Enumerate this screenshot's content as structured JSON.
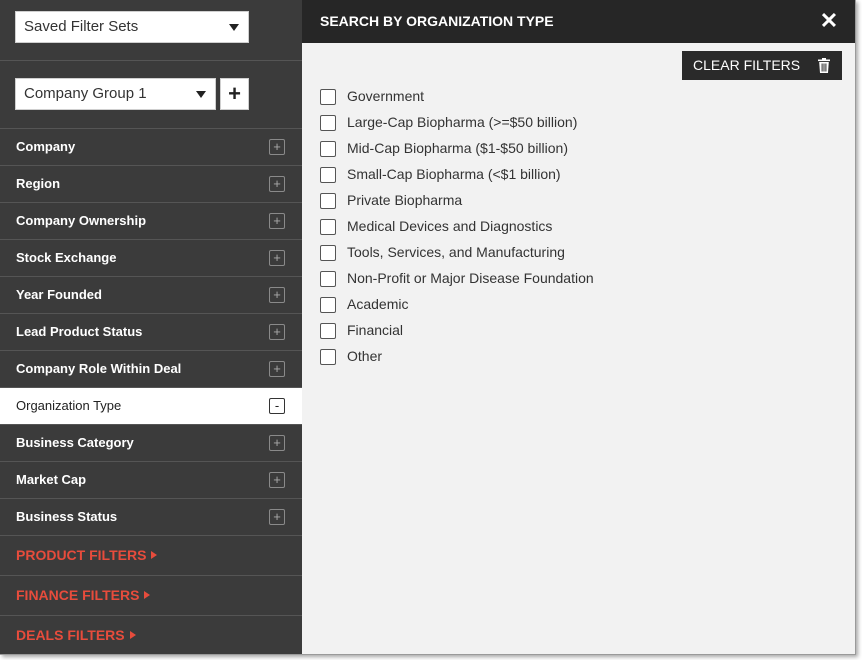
{
  "sidebar": {
    "saved_filter_sets": {
      "value": "Saved Filter Sets"
    },
    "company_group": {
      "value": "Company Group 1",
      "add_label": "+"
    },
    "filters": [
      {
        "label": "Company",
        "toggle": "+",
        "active": false
      },
      {
        "label": "Region",
        "toggle": "+",
        "active": false
      },
      {
        "label": "Company Ownership",
        "toggle": "+",
        "active": false
      },
      {
        "label": "Stock Exchange",
        "toggle": "+",
        "active": false
      },
      {
        "label": "Year Founded",
        "toggle": "+",
        "active": false
      },
      {
        "label": "Lead Product Status",
        "toggle": "+",
        "active": false
      },
      {
        "label": "Company Role Within Deal",
        "toggle": "+",
        "active": false
      },
      {
        "label": "Organization Type",
        "toggle": "-",
        "active": true
      },
      {
        "label": "Business Category",
        "toggle": "+",
        "active": false
      },
      {
        "label": "Market Cap",
        "toggle": "+",
        "active": false
      },
      {
        "label": "Business Status",
        "toggle": "+",
        "active": false
      }
    ],
    "sections": [
      {
        "label": "PRODUCT FILTERS"
      },
      {
        "label": "FINANCE FILTERS"
      },
      {
        "label": "DEALS FILTERS"
      }
    ]
  },
  "panel": {
    "title": "SEARCH BY ORGANIZATION TYPE",
    "close_label": "✕",
    "clear_label": "CLEAR FILTERS",
    "options": [
      {
        "label": "Government",
        "checked": false
      },
      {
        "label": "Large-Cap Biopharma (>=$50 billion)",
        "checked": false
      },
      {
        "label": "Mid-Cap Biopharma ($1-$50 billion)",
        "checked": false
      },
      {
        "label": "Small-Cap Biopharma (<$1 billion)",
        "checked": false
      },
      {
        "label": "Private Biopharma",
        "checked": false
      },
      {
        "label": "Medical Devices and Diagnostics",
        "checked": false
      },
      {
        "label": "Tools, Services, and Manufacturing",
        "checked": false
      },
      {
        "label": "Non-Profit or Major Disease Foundation",
        "checked": false
      },
      {
        "label": "Academic",
        "checked": false
      },
      {
        "label": "Financial",
        "checked": false
      },
      {
        "label": "Other",
        "checked": false
      }
    ]
  },
  "colors": {
    "sidebar_bg": "#3b3b3b",
    "header_bg": "#262626",
    "panel_bg": "#f2f2f2",
    "accent": "#e74c3c"
  }
}
